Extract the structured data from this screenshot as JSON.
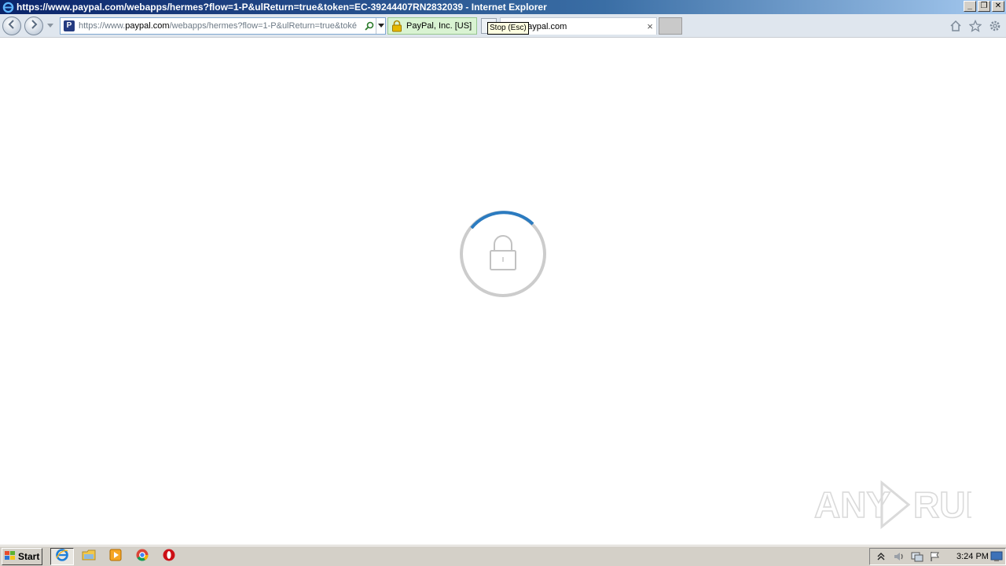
{
  "window": {
    "title": "https://www.paypal.com/webapps/hermes?flow=1-P&ulReturn=true&token=EC-39244407RN2832039 - Internet Explorer",
    "controls": [
      "minimize",
      "restore",
      "close"
    ]
  },
  "navigation": {
    "address": {
      "prefix": "https://www.",
      "domain": "paypal.com",
      "path": "/webapps/hermes?flow=1-P&ulReturn=true&toké"
    },
    "certificate": "PayPal, Inc. [US]",
    "tooltip": "Stop (Esc)",
    "tab": {
      "title": "paypal.com",
      "close": "×"
    },
    "icons": [
      "back-icon",
      "forward-icon",
      "search-icon",
      "home-icon",
      "favorites-star-icon",
      "settings-gear-icon"
    ]
  },
  "content": {
    "state": "loading",
    "spinner_icon": "lock-icon",
    "spinner_color": "#2b7bc0",
    "ring_color": "#cccccc"
  },
  "watermark": {
    "text": "ANY.RUN"
  },
  "taskbar": {
    "start_label": "Start",
    "items": [
      "internet-explorer-icon",
      "file-explorer-icon",
      "media-player-icon",
      "chrome-icon",
      "opera-icon"
    ],
    "clock": "3:24 PM"
  }
}
